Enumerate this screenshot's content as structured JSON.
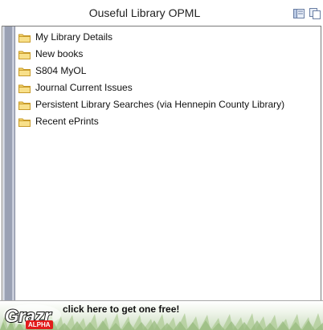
{
  "window": {
    "title": "Ouseful Library OPML"
  },
  "tree": {
    "items": [
      {
        "label": "My Library Details",
        "icon": "folder-icon"
      },
      {
        "label": "New books",
        "icon": "folder-icon"
      },
      {
        "label": "S804 MyOL",
        "icon": "folder-icon"
      },
      {
        "label": "Journal Current Issues",
        "icon": "folder-icon"
      },
      {
        "label": "Persistent Library Searches (via Hennepin County Library)",
        "icon": "folder-icon"
      },
      {
        "label": "Recent ePrints",
        "icon": "folder-icon"
      }
    ]
  },
  "footer": {
    "logo_text": "Grazr",
    "logo_badge": "ALPHA",
    "promo_text": "click here to get one free!"
  },
  "colors": {
    "folder": "#f3d36b",
    "sidebar": "#9aa1b4",
    "badge": "#e21b1b"
  }
}
